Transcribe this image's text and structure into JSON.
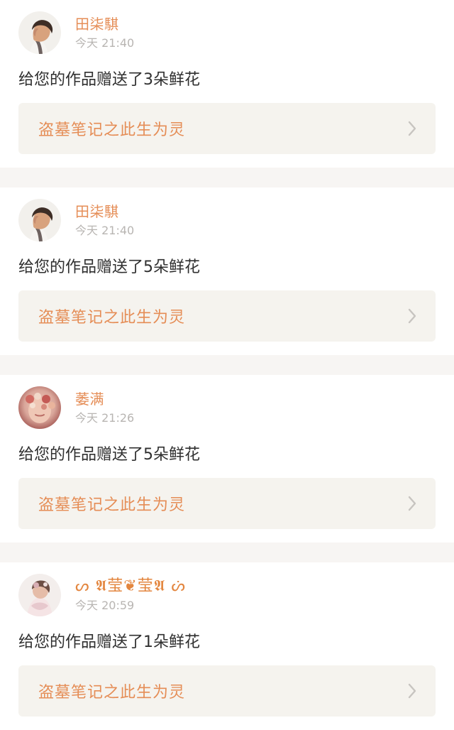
{
  "notifications": [
    {
      "user": "田柒騏",
      "time": "今天 21:40",
      "message": "给您的作品赠送了3朵鲜花",
      "work_title": "盗墓笔记之此生为灵",
      "avatar": "profile-photo-side-portrait"
    },
    {
      "user": "田柒騏",
      "time": "今天 21:40",
      "message": "给您的作品赠送了5朵鲜花",
      "work_title": "盗墓笔记之此生为灵",
      "avatar": "profile-photo-side-portrait"
    },
    {
      "user": "萎满",
      "time": "今天 21:26",
      "message": "给您的作品赠送了5朵鲜花",
      "work_title": "盗墓笔记之此生为灵",
      "avatar": "profile-photo-floral-face"
    },
    {
      "user": "ᔕ 𝕬莹❦莹𝕬 ᔖ",
      "time": "今天 20:59",
      "message": "给您的作品赠送了1朵鲜花",
      "work_title": "盗墓笔记之此生为灵",
      "avatar": "profile-photo-pink-costume"
    }
  ],
  "icons": {
    "chevron": "chevron-right-icon"
  },
  "colors": {
    "page_background": "#f7f5f3",
    "card_background": "#ffffff",
    "accent_orange": "#e58d56",
    "muted_text": "#b8b5b2",
    "primary_text": "#2f2f2f",
    "link_card_background": "#f5f3ee",
    "chevron_gray": "#c7c4c0"
  }
}
